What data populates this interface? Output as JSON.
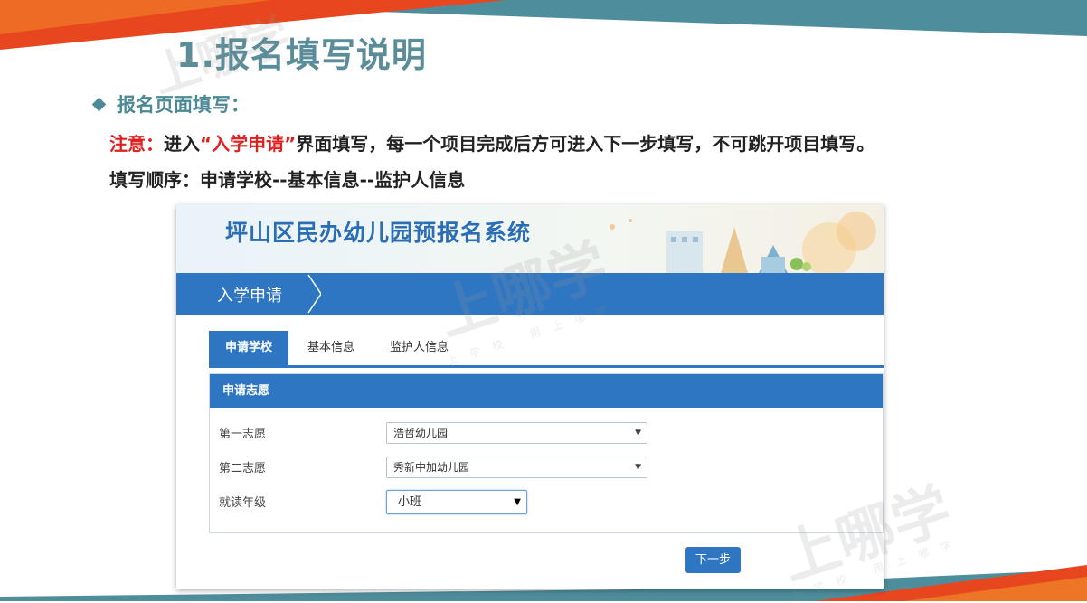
{
  "slide": {
    "title": "1.报名填写说明",
    "bullet": "报名页面填写：",
    "note_label": "注意：",
    "note_prefix": "进入",
    "note_quote": "“入学申请”",
    "note_rest": "界面填写，每一个项目完成后方可进入下一步填写，不可跳开项目填写。",
    "order": "填写顺序：申请学校--基本信息--监护人信息"
  },
  "app": {
    "system_title": "坪山区民办幼儿园预报名系统",
    "bar_label": "入学申请",
    "tabs": [
      {
        "label": "申请学校",
        "active": true
      },
      {
        "label": "基本信息",
        "active": false
      },
      {
        "label": "监护人信息",
        "active": false
      }
    ],
    "panel_title": "申请志愿",
    "fields": [
      {
        "label": "第一志愿",
        "value": "浩哲幼儿园"
      },
      {
        "label": "第二志愿",
        "value": "秀新中加幼儿园"
      },
      {
        "label": "就读年级",
        "value": "小班"
      }
    ],
    "next_button": "下一步"
  },
  "watermark": {
    "text": "上哪学",
    "sub": "上学校 用上哪学"
  },
  "colors": {
    "primary_blue": "#2f76c2",
    "title_teal": "#5a8c99",
    "note_red": "#e02020",
    "deco_orange": "#e8461e"
  }
}
